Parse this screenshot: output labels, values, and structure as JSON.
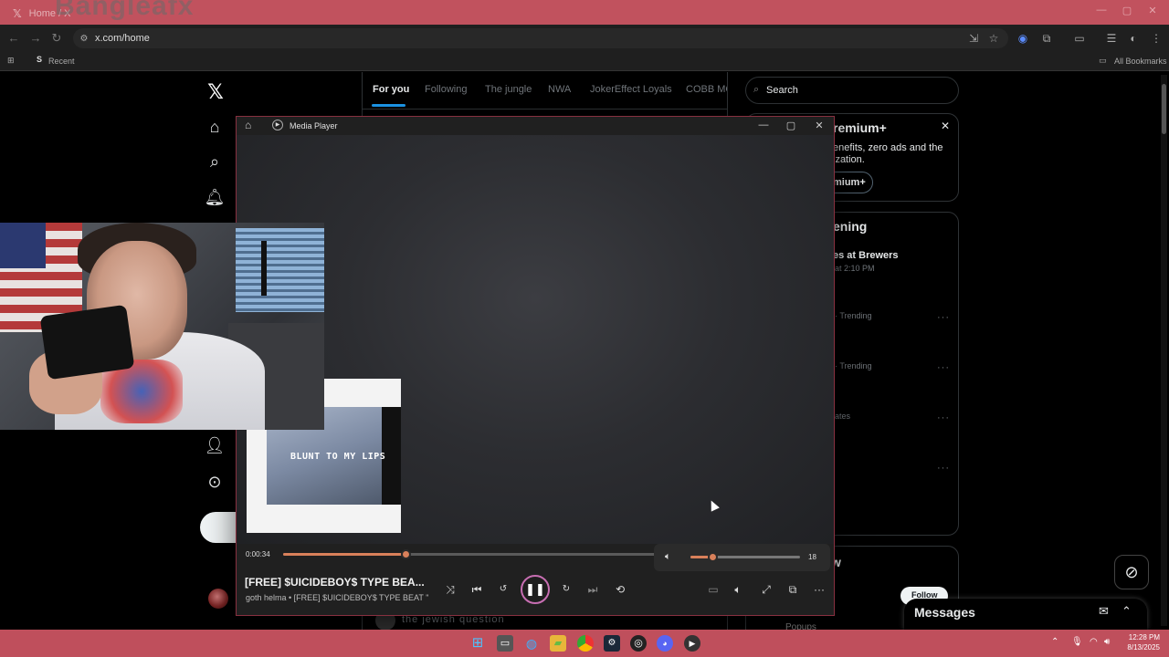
{
  "browser": {
    "tab_title": "Home / X",
    "overlay_brand": "Bangleafx",
    "address": "x.com/home",
    "bookmarks": {
      "recent": "Recent",
      "all_bookmarks": "All Bookmarks"
    }
  },
  "x_page": {
    "feed_tabs": [
      "For you",
      "Following",
      "The jungle",
      "NWA",
      "JokerEffect Loyals",
      "COBB MC"
    ],
    "search_placeholder": "Search",
    "premium": {
      "title": "remium+",
      "desc_line1": "enefits, zero ads and the",
      "desc_line2": "ization.",
      "button": "mium+"
    },
    "happening": {
      "title": "ening",
      "trend1_title": "es at Brewers",
      "trend1_sub": "at 2:10 PM",
      "trend2_meta": "· Trending",
      "trend3_meta": "· Trending",
      "trend4_meta": "ates"
    },
    "who_to_follow_fragment": "w",
    "follow_label": "Follow",
    "feed_bottom_text": "the jewish question",
    "rightpanel_bottom_text": "Popups",
    "messages_title": "Messages"
  },
  "media_player": {
    "title": "Media Player",
    "time_current": "0:00:34",
    "progress_fraction": 0.33,
    "volume_value": "18",
    "volume_fraction": 0.21,
    "track_title": "[FREE] $UICIDEBOY$ TYPE BEA...",
    "track_subtitle": "goth helma • [FREE] $UICIDEBOY$ TYPE BEAT \"...",
    "thumbnail_text": "BLUNT TO MY LIPS"
  },
  "taskbar": {
    "time": "12:28 PM",
    "date": "8/13/2025"
  },
  "colors": {
    "accent": "#d9805a",
    "x_blue": "#1d9bf0",
    "taskbar": "#bf4f5c",
    "pause_ring": "#c76eb2"
  },
  "icons": {
    "sidebar": [
      "home-icon",
      "search-icon",
      "bell-icon",
      "profile-icon",
      "more-icon"
    ],
    "player_controls": [
      "shuffle-icon",
      "previous-icon",
      "rewind-10-icon",
      "pause-icon",
      "forward-30-icon",
      "next-icon",
      "repeat-off-icon"
    ]
  }
}
